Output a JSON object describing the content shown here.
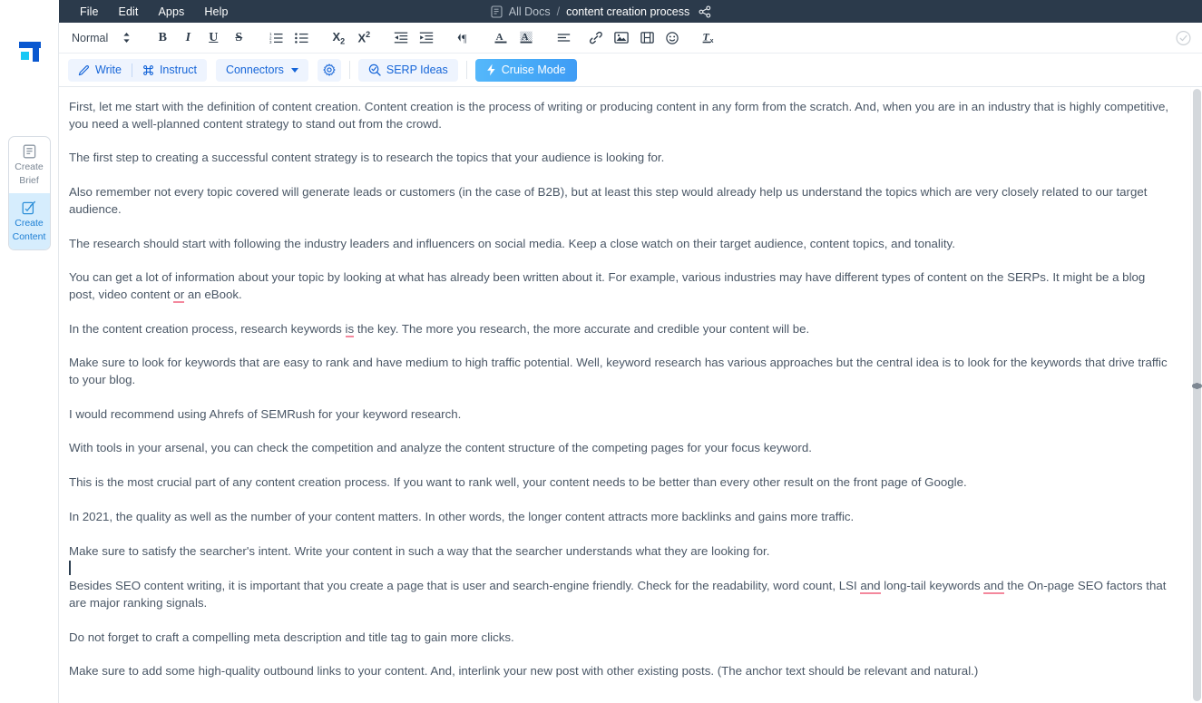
{
  "topbar": {
    "menu": [
      {
        "label": "File",
        "name": "menu-file"
      },
      {
        "label": "Edit",
        "name": "menu-edit"
      },
      {
        "label": "Apps",
        "name": "menu-apps"
      },
      {
        "label": "Help",
        "name": "menu-help"
      }
    ],
    "breadcrumb": {
      "doc_icon": "document-icon",
      "all_docs": "All Docs",
      "separator": "/",
      "title": "content creation process",
      "share_icon": "share-icon"
    }
  },
  "rail": {
    "logo": "app-logo",
    "items": [
      {
        "label_line1": "Create",
        "label_line2": "Brief",
        "icon": "brief-document-icon",
        "active": false
      },
      {
        "label_line1": "Create",
        "label_line2": "Content",
        "icon": "compose-pencil-icon",
        "active": true
      }
    ]
  },
  "format_toolbar": {
    "style_value": "Normal",
    "style_caret_icon": "updown-chevron-icon",
    "buttons": [
      {
        "name": "bold-button",
        "glyph": "B"
      },
      {
        "name": "italic-button",
        "glyph": "I"
      },
      {
        "name": "underline-button",
        "glyph": "U"
      },
      {
        "name": "strikethrough-button",
        "glyph": "S"
      },
      {
        "name": "ordered-list-button",
        "glyph": "ordered-list-icon"
      },
      {
        "name": "unordered-list-button",
        "glyph": "bullet-list-icon"
      },
      {
        "name": "subscript-button",
        "glyph": "X2"
      },
      {
        "name": "superscript-button",
        "glyph": "X^2"
      },
      {
        "name": "outdent-button",
        "glyph": "outdent-icon"
      },
      {
        "name": "indent-button",
        "glyph": "indent-icon"
      },
      {
        "name": "text-direction-button",
        "glyph": "paragraph-direction-icon"
      },
      {
        "name": "text-color-button",
        "glyph": "text-color-icon"
      },
      {
        "name": "highlight-color-button",
        "glyph": "highlight-icon"
      },
      {
        "name": "align-button",
        "glyph": "align-left-icon"
      },
      {
        "name": "insert-link-button",
        "glyph": "link-icon"
      },
      {
        "name": "insert-image-button",
        "glyph": "image-icon"
      },
      {
        "name": "insert-video-button",
        "glyph": "video-icon"
      },
      {
        "name": "insert-emoji-button",
        "glyph": "emoji-icon"
      },
      {
        "name": "clear-formatting-button",
        "glyph": "clear-format-icon"
      }
    ],
    "saved_indicator": "check-circle-icon"
  },
  "action_toolbar": {
    "write_label": "Write",
    "write_icon": "pencil-icon",
    "instruct_label": "Instruct",
    "instruct_icon": "command-key-icon",
    "connectors_label": "Connectors",
    "connectors_caret": "chevron-down-icon",
    "settings_icon": "gear-icon",
    "serp_label": "SERP Ideas",
    "serp_icon": "magnifier-check-icon",
    "cruise_label": "Cruise Mode",
    "cruise_icon": "lightning-bolt-icon"
  },
  "document": {
    "paragraphs": [
      {
        "id": "p1",
        "text": "First, let me start with the definition of content creation. Content creation is the process of writing or producing content in any form from the scratch. And, when you are in an industry that is highly competitive, you need a well-planned content strategy to stand out from the crowd."
      },
      {
        "id": "p2",
        "text": "The first step to creating a successful content strategy is to research the topics that your audience is looking for."
      },
      {
        "id": "p3",
        "text": "Also remember not every topic covered will generate leads or customers (in the case of B2B), but at least this step would already help us understand the topics which are very closely related to our target audience."
      },
      {
        "id": "p4",
        "text": "The research should start with following the industry leaders and influencers on social media. Keep a close watch on their target audience, content topics, and tonality."
      },
      {
        "id": "p5",
        "pre": "You can get a lot of information about your topic by looking at what has already been written about it. For example, various industries may have different types of content on the SERPs. It might be a blog post, video content ",
        "suggestion": "or",
        "post": " an eBook."
      },
      {
        "id": "p6",
        "pre": "In the content creation process, research keywords ",
        "suggestion": "is",
        "post": " the key. The more you research, the more accurate and credible your content will be."
      },
      {
        "id": "p7",
        "text": "Make sure to look for keywords that are easy to rank and have medium to high traffic potential. Well, keyword research has various approaches but the central idea is to look for the keywords that drive traffic to your blog."
      },
      {
        "id": "p8",
        "text": "I would recommend using Ahrefs of SEMRush for your keyword research."
      },
      {
        "id": "p9",
        "text": "With tools in your arsenal, you can check the competition and analyze the content structure of the competing pages for your focus keyword."
      },
      {
        "id": "p10",
        "text": "This is the most crucial part of any content creation process. If you want to rank well, your content needs to be better than every other result on the front page of Google."
      },
      {
        "id": "p11",
        "text": "In 2021, the quality as well as the number of your content matters. In other words, the longer content attracts more backlinks and gains more traffic."
      },
      {
        "id": "p12",
        "text": "Make sure to satisfy the searcher's intent. Write your content in such a way that the searcher understands what they are looking for."
      },
      {
        "id": "p13",
        "pre": "Besides SEO content writing, it is important that you create a page that is user and search-engine friendly. Check for the readability, word count, LSI ",
        "suggestion": "and",
        "mid": " long-tail keywords ",
        "suggestion2": "and",
        "post": " the On-page SEO factors that are major ranking signals."
      },
      {
        "id": "p14",
        "text": " Do not forget to craft a compelling meta description and title tag to gain more clicks."
      },
      {
        "id": "p15",
        "text": "Make sure to add some high-quality outbound links to your content. And, interlink your new post with other existing posts. (The anchor text should be relevant and natural.)"
      }
    ],
    "cursor_visible": true
  },
  "colors": {
    "topbar_bg": "#2b3a4b",
    "accent_blue": "#1565d8",
    "pill_bg": "#eef4fe",
    "cruise_bg": "#46a9f7",
    "active_rail_bg": "#d6edfd",
    "suggestion_underline": "#f4889d",
    "doc_text": "#4a5766"
  }
}
